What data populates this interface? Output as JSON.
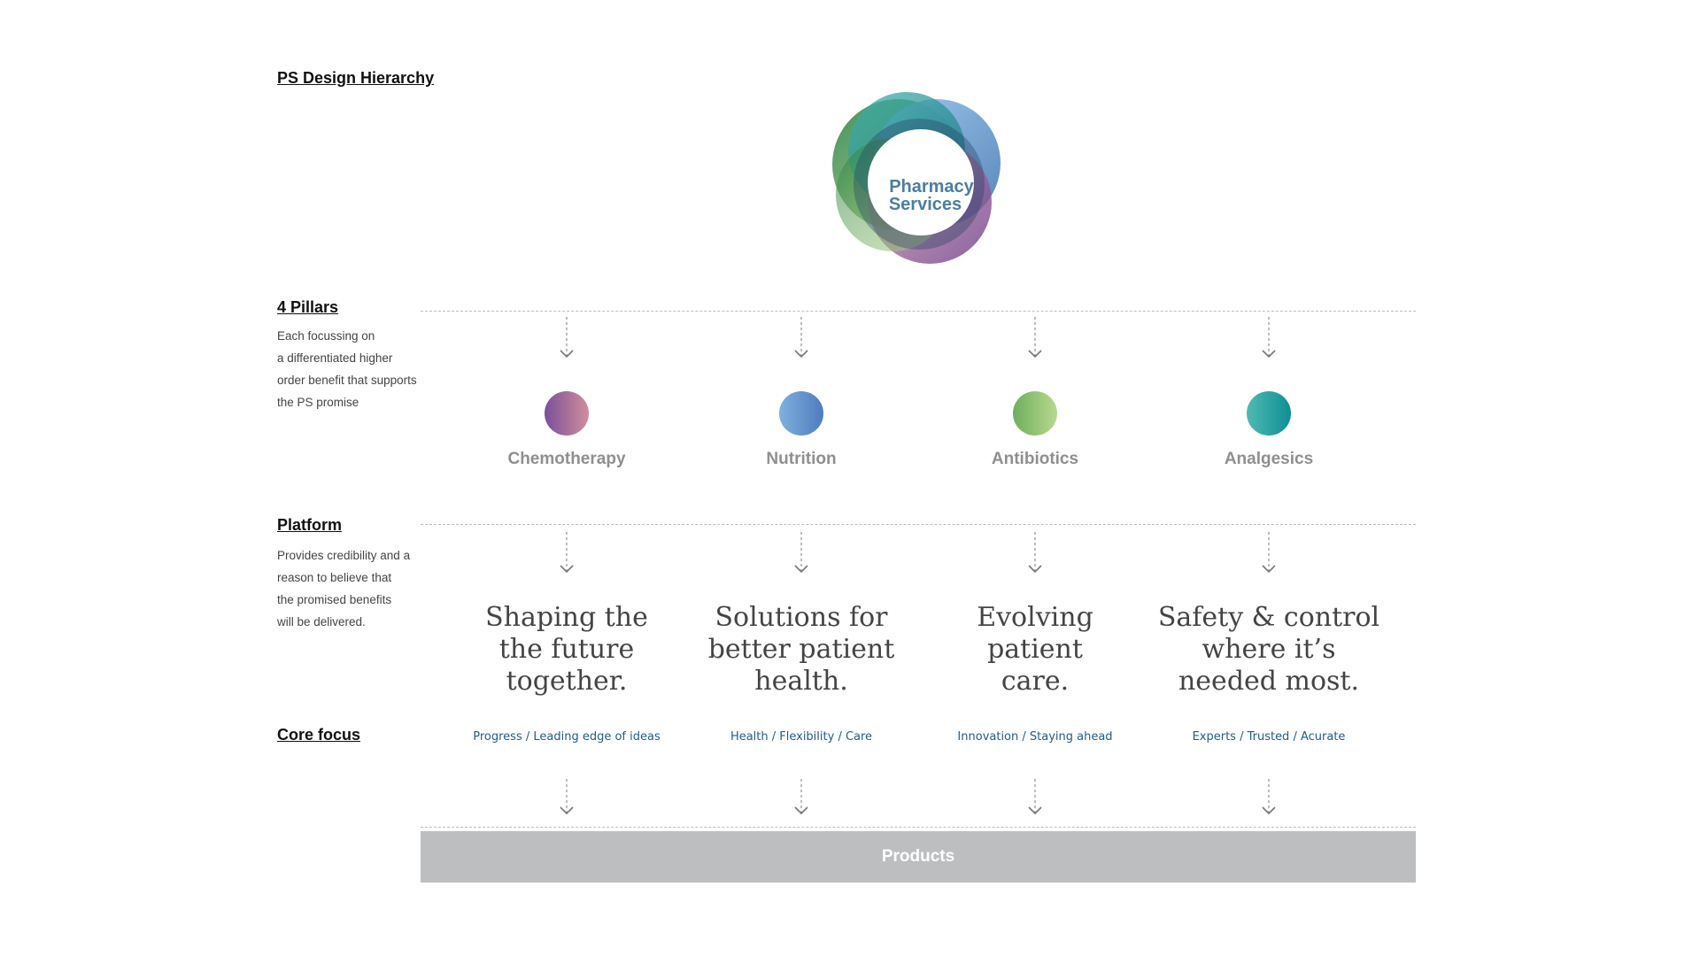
{
  "title": "PS Design Hierarchy",
  "logo": {
    "line1": "Pharmacy",
    "line2": "Services"
  },
  "sections": {
    "pillars": {
      "heading": "4 Pillars",
      "desc": [
        "Each focussing on",
        "a differentiated higher",
        "order benefit that supports",
        "the PS promise"
      ]
    },
    "platform": {
      "heading": "Platform",
      "desc": [
        "Provides credibility and a",
        "reason to believe that",
        "the promised benefits",
        "will be delivered."
      ]
    },
    "core": {
      "heading": "Core focus"
    }
  },
  "pillars": [
    {
      "label": "Chemotherapy",
      "color_from": "#7a4f9a",
      "color_to": "#d18f9b"
    },
    {
      "label": "Nutrition",
      "color_from": "#7fb1df",
      "color_to": "#4f7bbd"
    },
    {
      "label": "Antibiotics",
      "color_from": "#6fae5e",
      "color_to": "#b8d98f"
    },
    {
      "label": "Analgesics",
      "color_from": "#4fbab3",
      "color_to": "#0e8f94"
    }
  ],
  "platform": [
    {
      "lines": [
        "Shaping the",
        "the future",
        "together."
      ]
    },
    {
      "lines": [
        "Solutions for",
        "better patient",
        "health."
      ]
    },
    {
      "lines": [
        "Evolving",
        "patient",
        "care."
      ]
    },
    {
      "lines": [
        "Safety & control",
        "where it’s",
        "needed most."
      ]
    }
  ],
  "core_focus": [
    "Progress / Leading edge of ideas",
    "Health / Flexibility / Care",
    "Innovation / Staying ahead",
    "Experts / Trusted / Acurate"
  ],
  "products": {
    "label": "Products"
  },
  "colors": {
    "core_text": "#1f5d8a",
    "pillar_label": "#8f8f8f",
    "products_bar": "#bdbebf",
    "dashed_line": "#bdbdbd"
  }
}
